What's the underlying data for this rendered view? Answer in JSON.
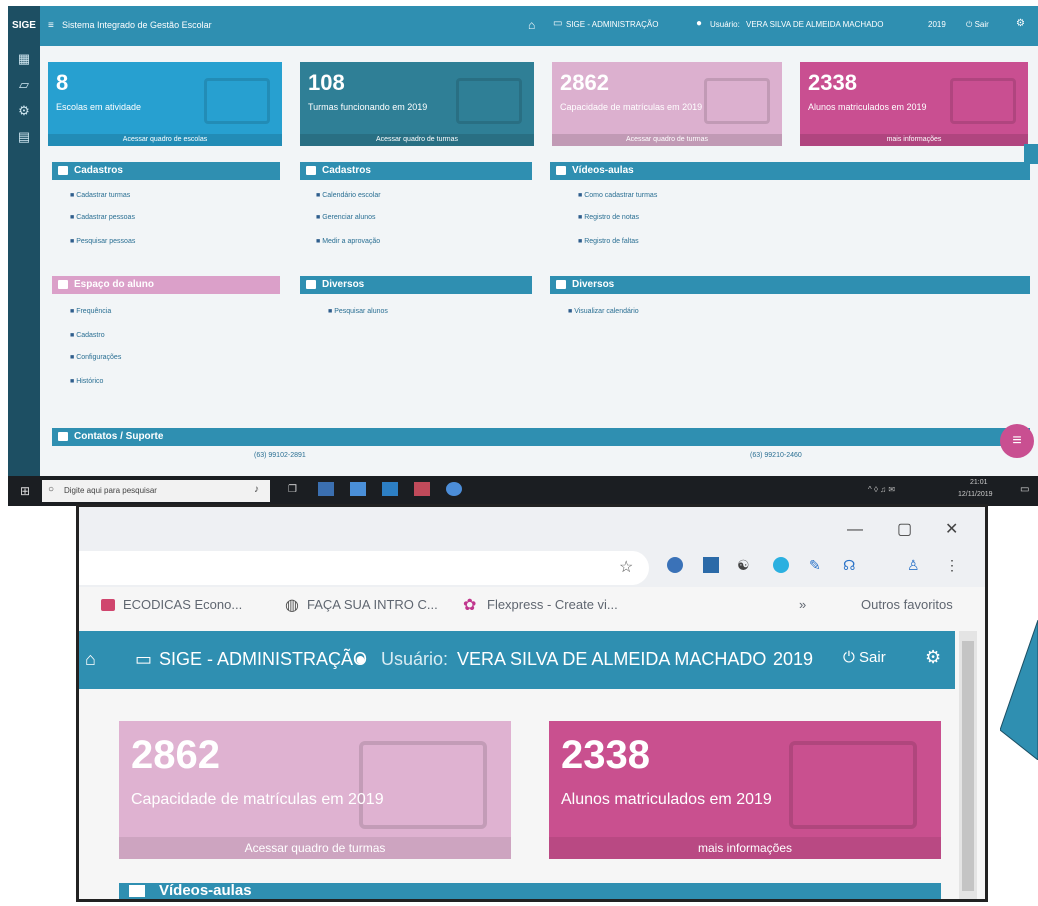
{
  "app": {
    "logo": "SIGE",
    "menu_icon": "menu-icon",
    "title": "Sistema Integrado de Gestão Escolar",
    "module": "SIGE - ADMINISTRAÇÃO",
    "user_label": "Usuário:",
    "user_name": "VERA SILVA DE ALMEIDA MACHADO",
    "year": "2019",
    "logout": "Sair",
    "colors": {
      "primary": "#2f8fb1",
      "sidebar": "#1d4f63",
      "pink": "#dfa9cc",
      "magenta": "#c94f91",
      "teal": "#2f7f96"
    }
  },
  "cards": [
    {
      "value": "8",
      "label": "Escolas em atividade",
      "footer": "Acessar quadro de escolas"
    },
    {
      "value": "108",
      "label": "Turmas funcionando em 2019",
      "footer": "Acessar quadro de turmas"
    },
    {
      "value": "2862",
      "label": "Capacidade de matrículas em 2019",
      "footer": "Acessar quadro de turmas"
    },
    {
      "value": "2338",
      "label": "Alunos matriculados em 2019",
      "footer": "mais informações"
    }
  ],
  "sections": [
    {
      "title": "Cadastros",
      "links": [
        "Cadastrar turmas",
        "Cadastrar pessoas",
        "Pesquisar pessoas"
      ]
    },
    {
      "title": "Cadastros",
      "links": [
        "Calendário escolar",
        "Gerenciar alunos",
        "Medir a aprovação"
      ]
    },
    {
      "title": "Vídeos-aulas",
      "links": [
        "Como cadastrar turmas",
        "Registro de notas",
        "Registro de faltas"
      ]
    },
    {
      "title": "Espaço do aluno",
      "links": [
        "Frequência",
        "Cadastro",
        "Configurações",
        "Histórico"
      ]
    },
    {
      "title": "Diversos",
      "links": [
        "Pesquisar alunos"
      ]
    },
    {
      "title": "Diversos",
      "links": [
        "Visualizar calendário"
      ]
    }
  ],
  "contacts": {
    "title": "Contatos / Suporte",
    "phone1": "(63) 99102-2891",
    "phone2": "(63) 99210-2460"
  },
  "taskbar": {
    "search": "Digite aqui para pesquisar",
    "time": "21:01",
    "date": "12/11/2019"
  },
  "browser": {
    "bookmarks": [
      "ECODICAS  Econo...",
      "FAÇA SUA INTRO C...",
      "Flexpress - Create vi..."
    ],
    "other_bookmarks": "Outros favoritos",
    "cards": [
      {
        "value": "2862",
        "label": "Capacidade de matrículas em 2019",
        "footer": "Acessar quadro de turmas"
      },
      {
        "value": "2338",
        "label": "Alunos matriculados em 2019",
        "footer": "mais informações"
      }
    ],
    "section_peek": "Vídeos-aulas"
  }
}
